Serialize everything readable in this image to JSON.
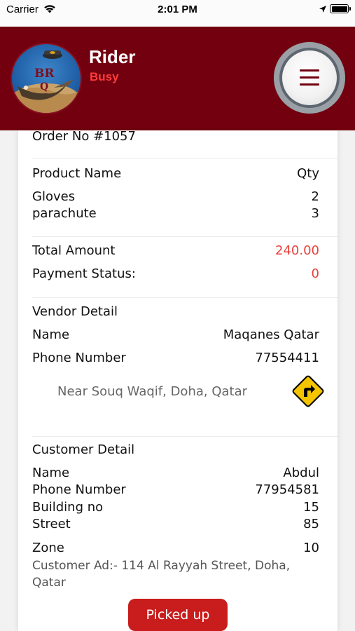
{
  "status_bar": {
    "carrier": "Carrier",
    "time": "2:01 PM"
  },
  "header": {
    "rider_name": "Rider",
    "rider_status": "Busy",
    "logo_text_top": "BR",
    "logo_text_bottom": "Q"
  },
  "order": {
    "order_no": "Order No #1057",
    "product_header": "Product Name",
    "qty_header": "Qty",
    "items": [
      {
        "name": "Gloves",
        "qty": "2"
      },
      {
        "name": "parachute",
        "qty": "3"
      }
    ],
    "total_label": "Total Amount",
    "total_value": "240.00",
    "payment_label": "Payment Status:",
    "payment_value": "0"
  },
  "vendor": {
    "title": "Vendor Detail",
    "name_label": "Name",
    "name_value": "Maqanes Qatar",
    "phone_label": "Phone Number",
    "phone_value": "77554411",
    "address": "Near Souq Waqif, Doha, Qatar"
  },
  "customer": {
    "title": "Customer Detail",
    "name_label": "Name",
    "name_value": "Abdul",
    "phone_label": "Phone Number",
    "phone_value": "77954581",
    "building_label": "Building no",
    "building_value": "15",
    "street_label": "Street",
    "street_value": "85",
    "zone_label": "Zone",
    "zone_value": "10",
    "address_line1": "Customer Ad:- 114 Al Rayyah Street, Doha,",
    "address_line2": "Qatar"
  },
  "actions": {
    "picked_up_label": "Picked up"
  },
  "colors": {
    "header_bg": "#73000f",
    "accent_red": "#e8403a",
    "button_red": "#c91c1c",
    "status_busy": "#ff3b3b",
    "route_sign": "#f5c400"
  },
  "icons": [
    "wifi-icon",
    "location-arrow-icon",
    "battery-icon",
    "menu-icon",
    "route-turn-icon"
  ]
}
